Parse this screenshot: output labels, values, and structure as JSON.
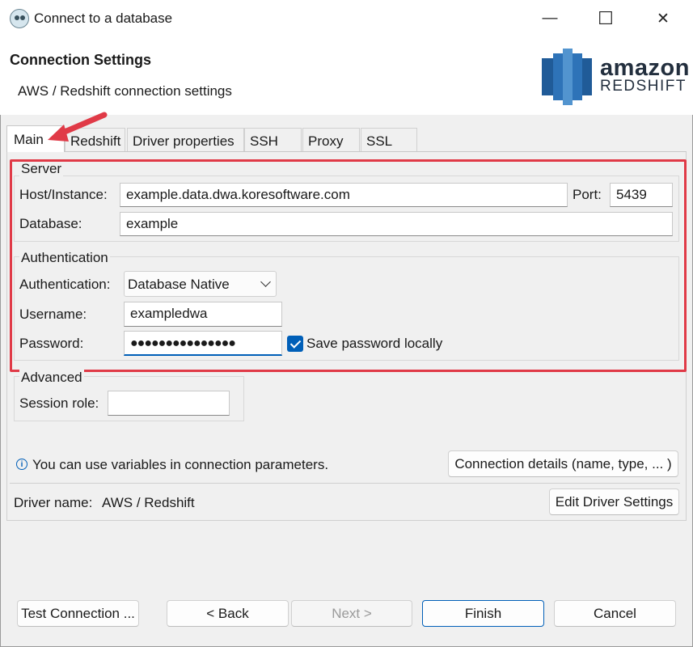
{
  "window": {
    "title": "Connect to a database",
    "controls": {
      "minimize": "—",
      "maximize": "☐",
      "close": "✕"
    }
  },
  "header": {
    "title": "Connection Settings",
    "subtitle": "AWS / Redshift connection settings",
    "logo": {
      "line1": "amazon",
      "line2": "REDSHIFT"
    }
  },
  "tabs": [
    {
      "label": "Main",
      "active": true
    },
    {
      "label": "Redshift",
      "active": false
    },
    {
      "label": "Driver properties",
      "active": false
    },
    {
      "label": "SSH",
      "active": false
    },
    {
      "label": "Proxy",
      "active": false
    },
    {
      "label": "SSL",
      "active": false
    }
  ],
  "server": {
    "legend": "Server",
    "host_label": "Host/Instance:",
    "host_value": "example.data.dwa.koresoftware.com",
    "port_label": "Port:",
    "port_value": "5439",
    "database_label": "Database:",
    "database_value": "example"
  },
  "auth": {
    "legend": "Authentication",
    "type_label": "Authentication:",
    "type_value": "Database Native",
    "username_label": "Username:",
    "username_value": "exampledwa",
    "password_label": "Password:",
    "password_value": "●●●●●●●●●●●●●●●",
    "save_password_label": "Save password locally",
    "save_password_checked": true
  },
  "advanced": {
    "legend": "Advanced",
    "session_role_label": "Session role:",
    "session_role_value": ""
  },
  "info": {
    "icon": "ⓘ",
    "text": "You can use variables in connection parameters.",
    "connection_details_button": "Connection details (name, type, ... )"
  },
  "driver": {
    "label": "Driver name:",
    "value": "AWS / Redshift",
    "edit_button": "Edit Driver Settings"
  },
  "footer": {
    "test_connection": "Test Connection ...",
    "back": "< Back",
    "next": "Next >",
    "finish": "Finish",
    "cancel": "Cancel"
  },
  "colors": {
    "annotation_red": "#e03a47",
    "accent_blue": "#005fb8",
    "redshift_blue": "#2e73b8"
  }
}
